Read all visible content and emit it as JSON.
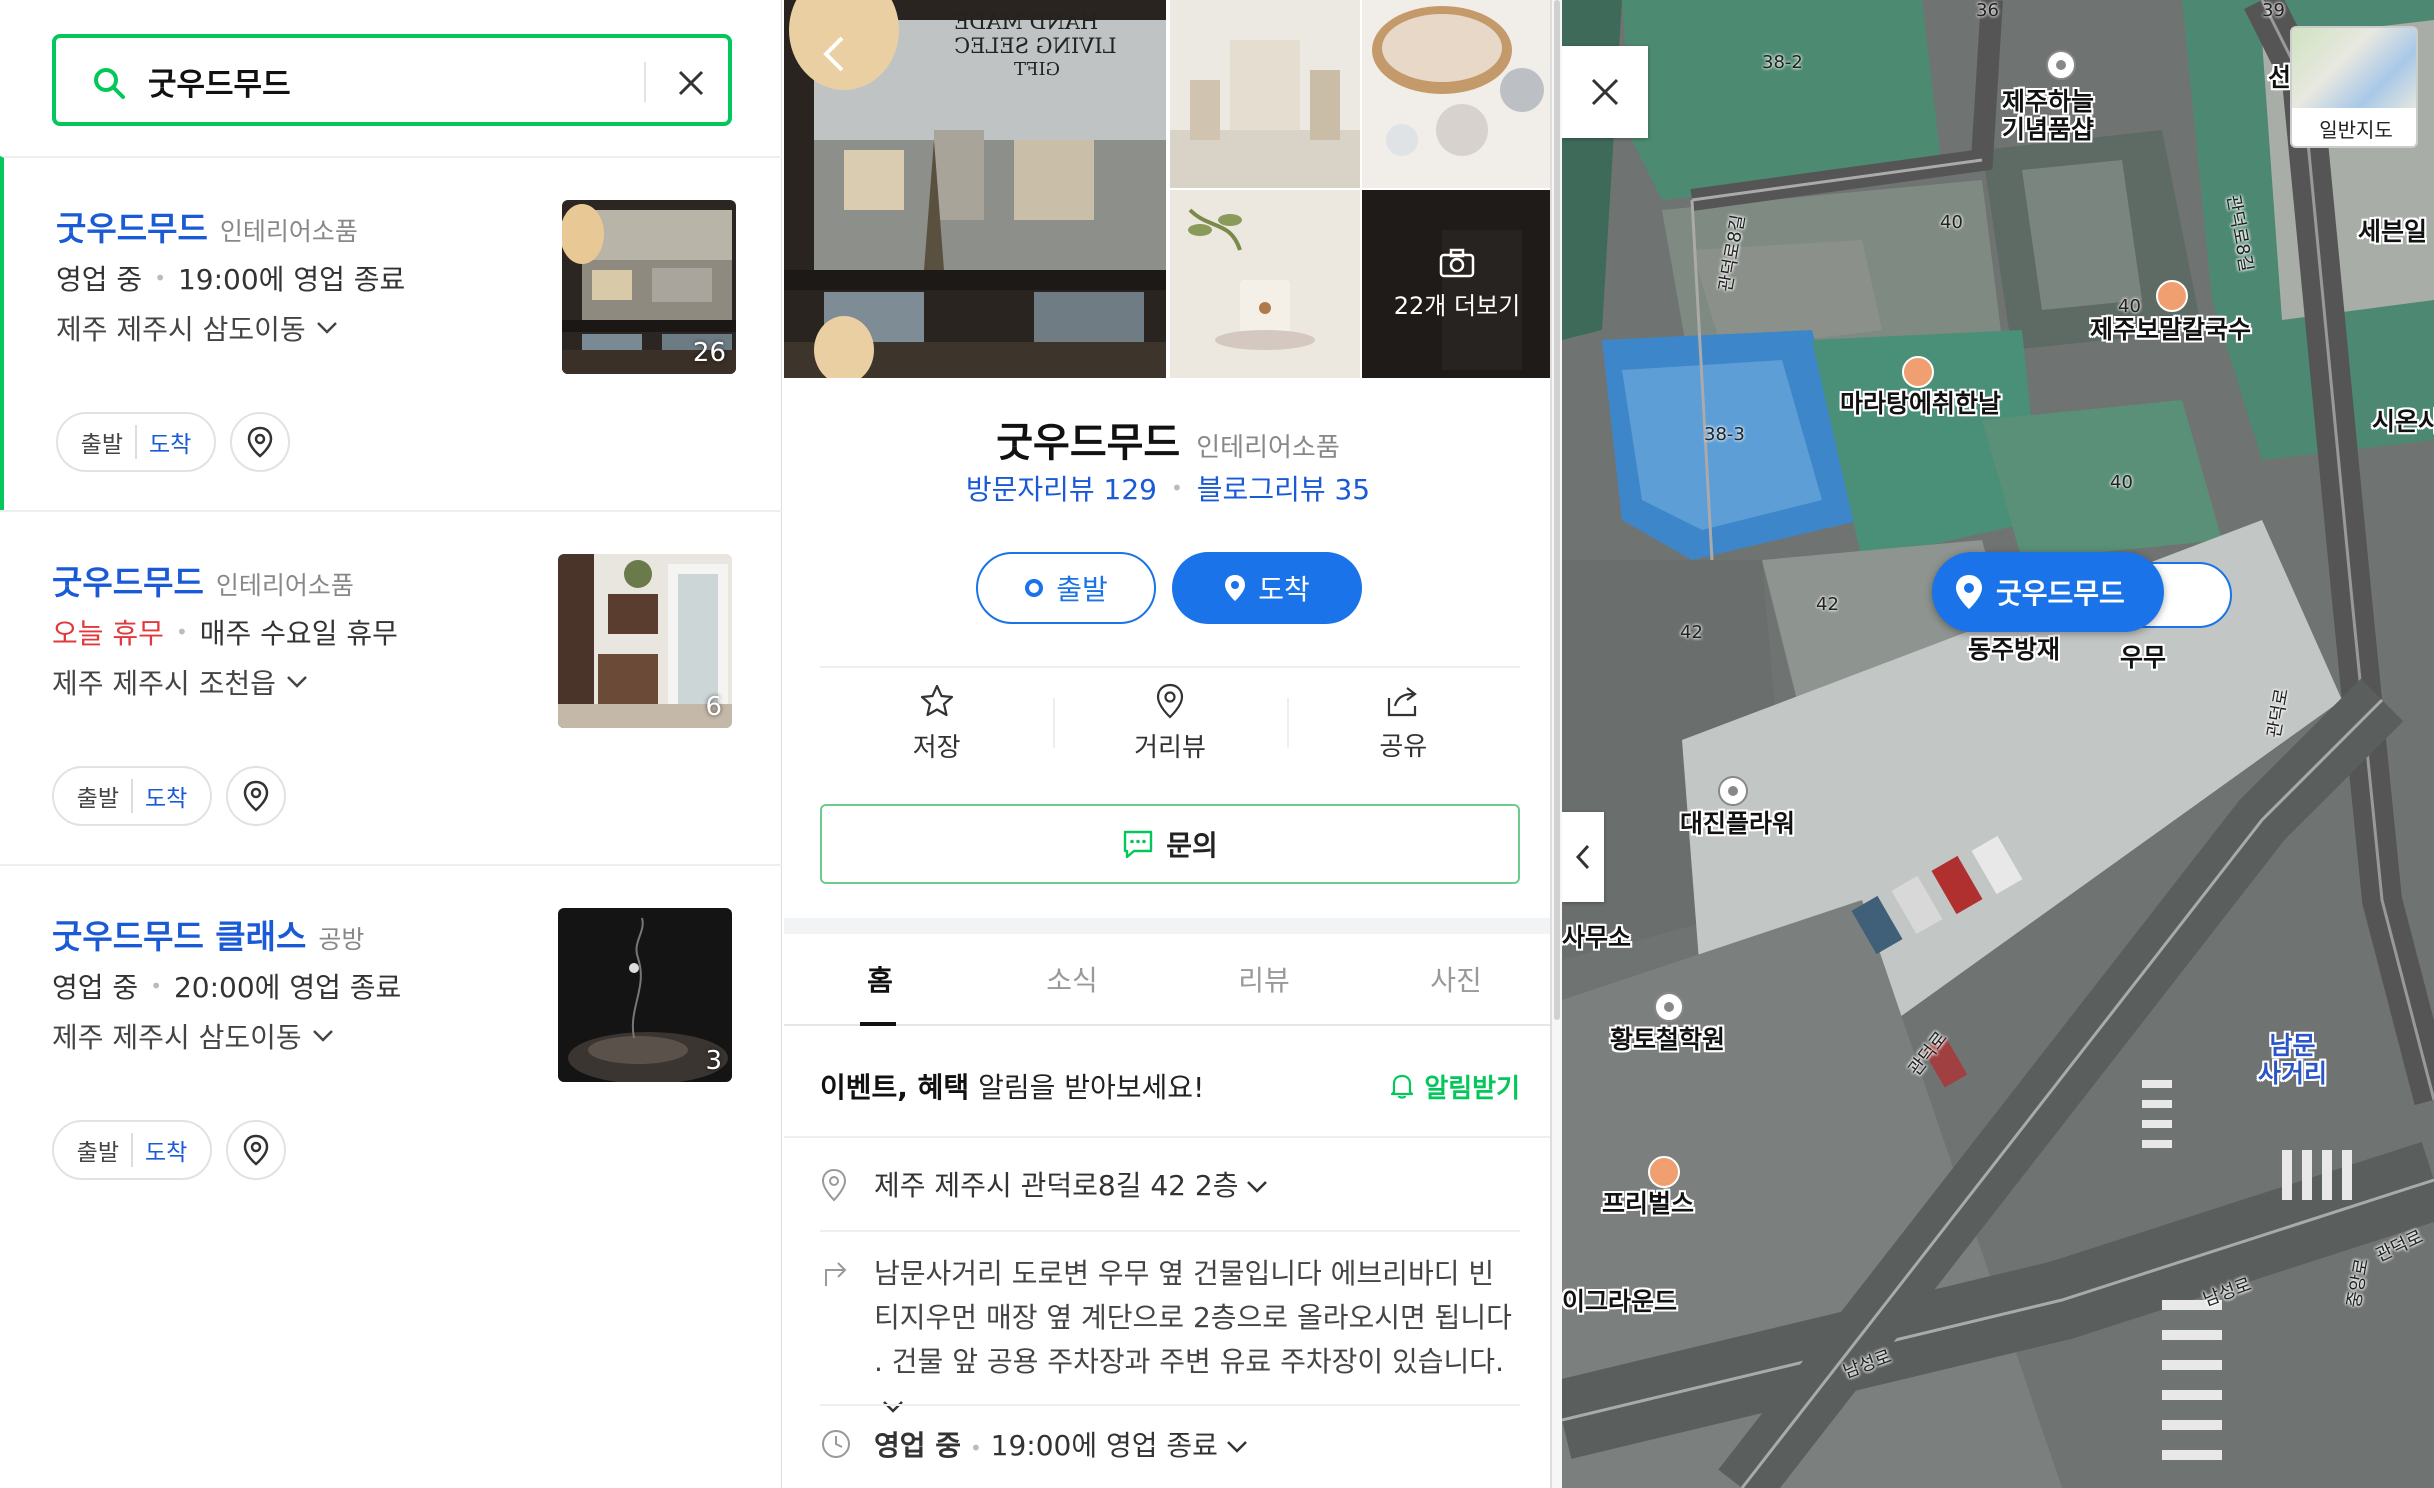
{
  "search": {
    "query": "굿우드무드"
  },
  "results": [
    {
      "name": "굿우드무드",
      "category": "인테리어소품",
      "status": "영업 중",
      "status_detail": "19:00에 영업 종료",
      "address": "제주 제주시 삼도이동",
      "photo_count": "26",
      "depart": "출발",
      "arrive": "도착"
    },
    {
      "name": "굿우드무드",
      "category": "인테리어소품",
      "status": "오늘 휴무",
      "status_detail": "매주 수요일 휴무",
      "address": "제주 제주시 조천읍",
      "photo_count": "6",
      "depart": "출발",
      "arrive": "도착"
    },
    {
      "name": "굿우드무드 클래스",
      "category": "공방",
      "status": "영업 중",
      "status_detail": "20:00에 영업 종료",
      "address": "제주 제주시 삼도이동",
      "photo_count": "3",
      "depart": "출발",
      "arrive": "도착"
    }
  ],
  "detail": {
    "photo_sign": [
      "HAND MADE",
      "LIVING SELEC",
      "GIFT"
    ],
    "more_photos": "22개 더보기",
    "title": "굿우드무드",
    "category": "인테리어소품",
    "visitor_reviews": "방문자리뷰 129",
    "blog_reviews": "블로그리뷰 35",
    "depart_btn": "출발",
    "arrive_btn": "도착",
    "actions": {
      "save": "저장",
      "street_view": "거리뷰",
      "share": "공유"
    },
    "inquiry": "문의",
    "tabs": [
      "홈",
      "소식",
      "리뷰",
      "사진"
    ],
    "notice_bold": "이벤트, 혜택",
    "notice_rest": " 알림을 받아보세요!",
    "notice_action": "알림받기",
    "address": "제주 제주시 관덕로8길 42 2층",
    "directions": "남문사거리 도로변 우무 옆 건물입니다 에브리바디 빈 티지우먼 매장 옆 계단으로 2층으로 올라오시면 됩니다 . 건물 앞 공용 주차장과 주변 유료 주차장이 있습니다.",
    "hours_status": "영업 중",
    "hours_detail": "19:00에 영업 종료"
  },
  "map": {
    "minimap_label": "일반지도",
    "marker_label": "굿우드무드",
    "labels": {
      "jejuhaneul": "제주하늘\n기념품샵",
      "jejubomal": "제주보말칼국수",
      "malatang": "마라탕에취한날",
      "dongju": "동주방재",
      "umu": "우무",
      "daejin": "대진플라워",
      "samuso": "사무소",
      "hwangto": "황토철학원",
      "freebells": "프리벌스",
      "playground": "이그라운드",
      "namun": "남문\n사거리",
      "sewol": "세븐일",
      "siwon": "시온시",
      "seon": "선"
    },
    "roads": {
      "gwandeok8": "관덕로8길",
      "gwandeok8b": "관덕로8길",
      "gwandeok": "관덕로",
      "namseong1": "남성로",
      "namseong2": "남성로",
      "jungang": "중앙로",
      "gwandeok_c": "관덕로",
      "gwandeok_r": "관덕로"
    },
    "numbers": [
      "38-2",
      "40",
      "40",
      "38-3",
      "40",
      "42",
      "42",
      "36",
      "39"
    ]
  }
}
